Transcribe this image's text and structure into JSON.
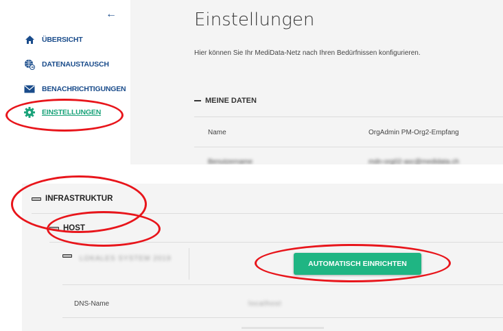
{
  "sidebar": {
    "items": [
      {
        "label": "ÜBERSICHT",
        "icon": "home-icon"
      },
      {
        "label": "DATENAUSTAUSCH",
        "icon": "globe-exchange-icon"
      },
      {
        "label": "BENACHRICHTIGUNGEN",
        "icon": "envelope-icon"
      },
      {
        "label": "EINSTELLUNGEN",
        "icon": "gear-icon",
        "active": true
      }
    ]
  },
  "settings": {
    "title": "Einstellungen",
    "description": "Hier können Sie Ihr MediData-Netz nach Ihren Bedürfnissen konfigurieren.",
    "section_title": "MEINE DATEN",
    "rows": [
      {
        "label": "Name",
        "value": "OrgAdmin PM-Org2-Empfang"
      },
      {
        "label": "Benutzername",
        "value": "mdn-org02-asc@medidata.ch"
      }
    ]
  },
  "infrastructure": {
    "title": "INFRASTRUKTUR",
    "host_title": "HOST",
    "system_name": "LOKALES SYSTEM 2019",
    "button_label": "AUTOMATISCH EINRICHTEN",
    "dns_label": "DNS-Name",
    "dns_value": "localhost"
  },
  "colors": {
    "nav_text": "#1a4c8b",
    "active_nav": "#1aa37a",
    "button": "#1fb583",
    "highlight": "#e8151b",
    "panel_bg": "#f4f4f4"
  }
}
